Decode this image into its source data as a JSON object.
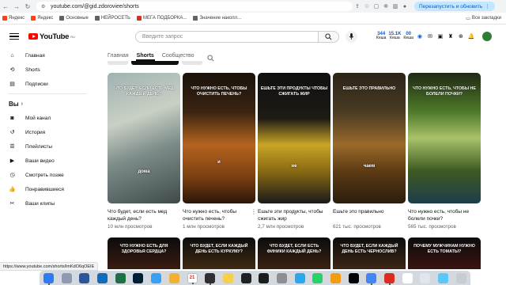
{
  "browser": {
    "url": "youtube.com/@gid.zdoroviee/shorts",
    "relaunch_label": "Перезапустить и обновить",
    "bookmarks": [
      {
        "label": "Яндекс",
        "color": "#fc3f1d"
      },
      {
        "label": "Яндекс",
        "color": "#fc3f1d"
      },
      {
        "label": "Основные",
        "color": "#5f6368"
      },
      {
        "label": "НЕЙРОСЕТЬ",
        "color": "#5f6368"
      },
      {
        "label": "МЕГА ПОДБОРКА...",
        "color": "#d93025"
      },
      {
        "label": "Значение накопл...",
        "color": "#5f6368"
      }
    ],
    "all_bookmarks_label": "Все закладки"
  },
  "header": {
    "logo_text": "YouTube",
    "logo_region": "RU",
    "search_placeholder": "Введите запрос",
    "stats": [
      {
        "value": "344",
        "label": "Кеша"
      },
      {
        "value": "15.1K",
        "label": "Кеша"
      },
      {
        "value": "00",
        "label": "Кеша"
      }
    ]
  },
  "sidebar": {
    "items_top": [
      {
        "label": "Главная",
        "icon": "home-icon",
        "glyph": "⌂"
      },
      {
        "label": "Shorts",
        "icon": "shorts-icon",
        "glyph": "⟲"
      },
      {
        "label": "Подписки",
        "icon": "subscriptions-icon",
        "glyph": "▤"
      }
    ],
    "you_heading": "Вы",
    "items_you": [
      {
        "label": "Мой канал",
        "icon": "channel-icon",
        "glyph": "◙"
      },
      {
        "label": "История",
        "icon": "history-icon",
        "glyph": "↺"
      },
      {
        "label": "Плейлисты",
        "icon": "playlists-icon",
        "glyph": "☰"
      },
      {
        "label": "Ваши видео",
        "icon": "your-videos-icon",
        "glyph": "▶"
      },
      {
        "label": "Смотреть позже",
        "icon": "watch-later-icon",
        "glyph": "◷"
      },
      {
        "label": "Понравившиеся",
        "icon": "liked-icon",
        "glyph": "👍"
      },
      {
        "label": "Ваши клипы",
        "icon": "clips-icon",
        "glyph": "✂"
      }
    ]
  },
  "channel_tabs": {
    "tabs": [
      "Главная",
      "Shorts",
      "Сообщество"
    ],
    "active_index": 1
  },
  "shorts": [
    {
      "caption": "Что будет, если есть мед каждый день?",
      "overlay": "дома",
      "title": "Что будет, если есть мед каждый день?",
      "views": "10 млн просмотров",
      "bg": "linear-gradient(160deg,#9fb3b2 0%,#c9cfc4 35%,#7d8d8a 60%,#3e4a4a 100%)"
    },
    {
      "caption": "Что нужно есть, чтобы очистить печень?",
      "overlay": "и",
      "title": "Что нужно есть, чтобы очистить печень?",
      "views": "1 млн просмотров",
      "bg": "linear-gradient(180deg,#1a120b 0%,#3a2411 30%,#b5641f 55%,#7a3f10 80%,#2a170a 100%)"
    },
    {
      "caption": "Ешьте эти продукты чтобы сжигать жир",
      "overlay": "не",
      "title": "Ешьте эти продукты, чтобы сжигать жир",
      "views": "2,7 млн просмотров",
      "bg": "linear-gradient(180deg,#101010 0%,#1e1b14 35%,#c9a526 55%,#8a6a12 75%,#1a1a1a 100%)"
    },
    {
      "caption": "Ешьте это правильно",
      "overlay": "чаем",
      "title": "Ешьте это правильно",
      "views": "621 тыс. просмотров",
      "bg": "linear-gradient(180deg,#2a2418 0%,#4a3b22 30%,#9a6a2a 55%,#5d3c14 75%,#2a1d0c 100%)"
    },
    {
      "caption": "Что нужно есть, чтобы не болели почки?",
      "overlay": "",
      "title": "Что нужно есть, чтобы не болели почки?",
      "views": "565 тыс. просмотров",
      "bg": "linear-gradient(180deg,#1f2a14 0%,#4f7a2a 30%,#a9c26a 50%,#3e5a22 75%,#1e3d4a 100%)"
    }
  ],
  "shorts_row2": [
    {
      "caption": "Что нужно есть для здоровья сердца?",
      "bg": "linear-gradient(180deg,#0c0c0c,#3a1c10)"
    },
    {
      "caption": "Что будет, если каждый день есть куркуму?",
      "bg": "linear-gradient(180deg,#0c0c0c,#402a12)"
    },
    {
      "caption": "Что будет, если есть финики каждый день?",
      "bg": "linear-gradient(180deg,#0c0c0c,#3a2212)"
    },
    {
      "caption": "Что будет, если каждый день есть чернослив?",
      "bg": "linear-gradient(180deg,#0c0c0c,#3d2616)"
    },
    {
      "caption": "Почему мужчинам нужно есть томаты?",
      "bg": "linear-gradient(180deg,#0c0c0c,#3a1410)"
    }
  ],
  "status_bar_url": "https://www.youtube.com/shorts/lmKdO6qOEIE",
  "dock": {
    "calendar_day": "21",
    "apps": [
      {
        "name": "finder-icon",
        "color": "#2f7bf5"
      },
      {
        "name": "launchpad-icon",
        "color": "#8e9aaf"
      },
      {
        "name": "word-icon",
        "color": "#2b579a"
      },
      {
        "name": "outlook-icon",
        "color": "#0f6cbd"
      },
      {
        "name": "excel-icon",
        "color": "#1e7145"
      },
      {
        "name": "photoshop-icon",
        "color": "#001e36"
      },
      {
        "name": "safari-icon",
        "color": "#3aa0f5"
      },
      {
        "name": "photos-icon",
        "color": "#f2b134"
      },
      {
        "name": "calendar-icon",
        "color": "#ffffff"
      },
      {
        "name": "obs-icon",
        "color": "#302e31"
      },
      {
        "name": "notes-icon",
        "color": "#f6d04d"
      },
      {
        "name": "chatgpt-icon",
        "color": "#202123"
      },
      {
        "name": "capcut-icon",
        "color": "#1c1c1c"
      },
      {
        "name": "settings-icon",
        "color": "#8e8e93"
      },
      {
        "name": "telegram-icon",
        "color": "#29a9eb"
      },
      {
        "name": "whatsapp-icon",
        "color": "#25d366"
      },
      {
        "name": "pages-icon",
        "color": "#f39c12"
      },
      {
        "name": "capcut2-icon",
        "color": "#000000"
      },
      {
        "name": "chrome-icon",
        "color": "#4285f4"
      },
      {
        "name": "acrobat-icon",
        "color": "#d92d20"
      },
      {
        "name": "yandex-icon",
        "color": "#ffffff"
      },
      {
        "name": "preview-icon",
        "color": "#dfe6ee"
      },
      {
        "name": "downloads-icon",
        "color": "#5ac8fa"
      },
      {
        "name": "trash-icon",
        "color": "#c7ccd2"
      }
    ]
  }
}
